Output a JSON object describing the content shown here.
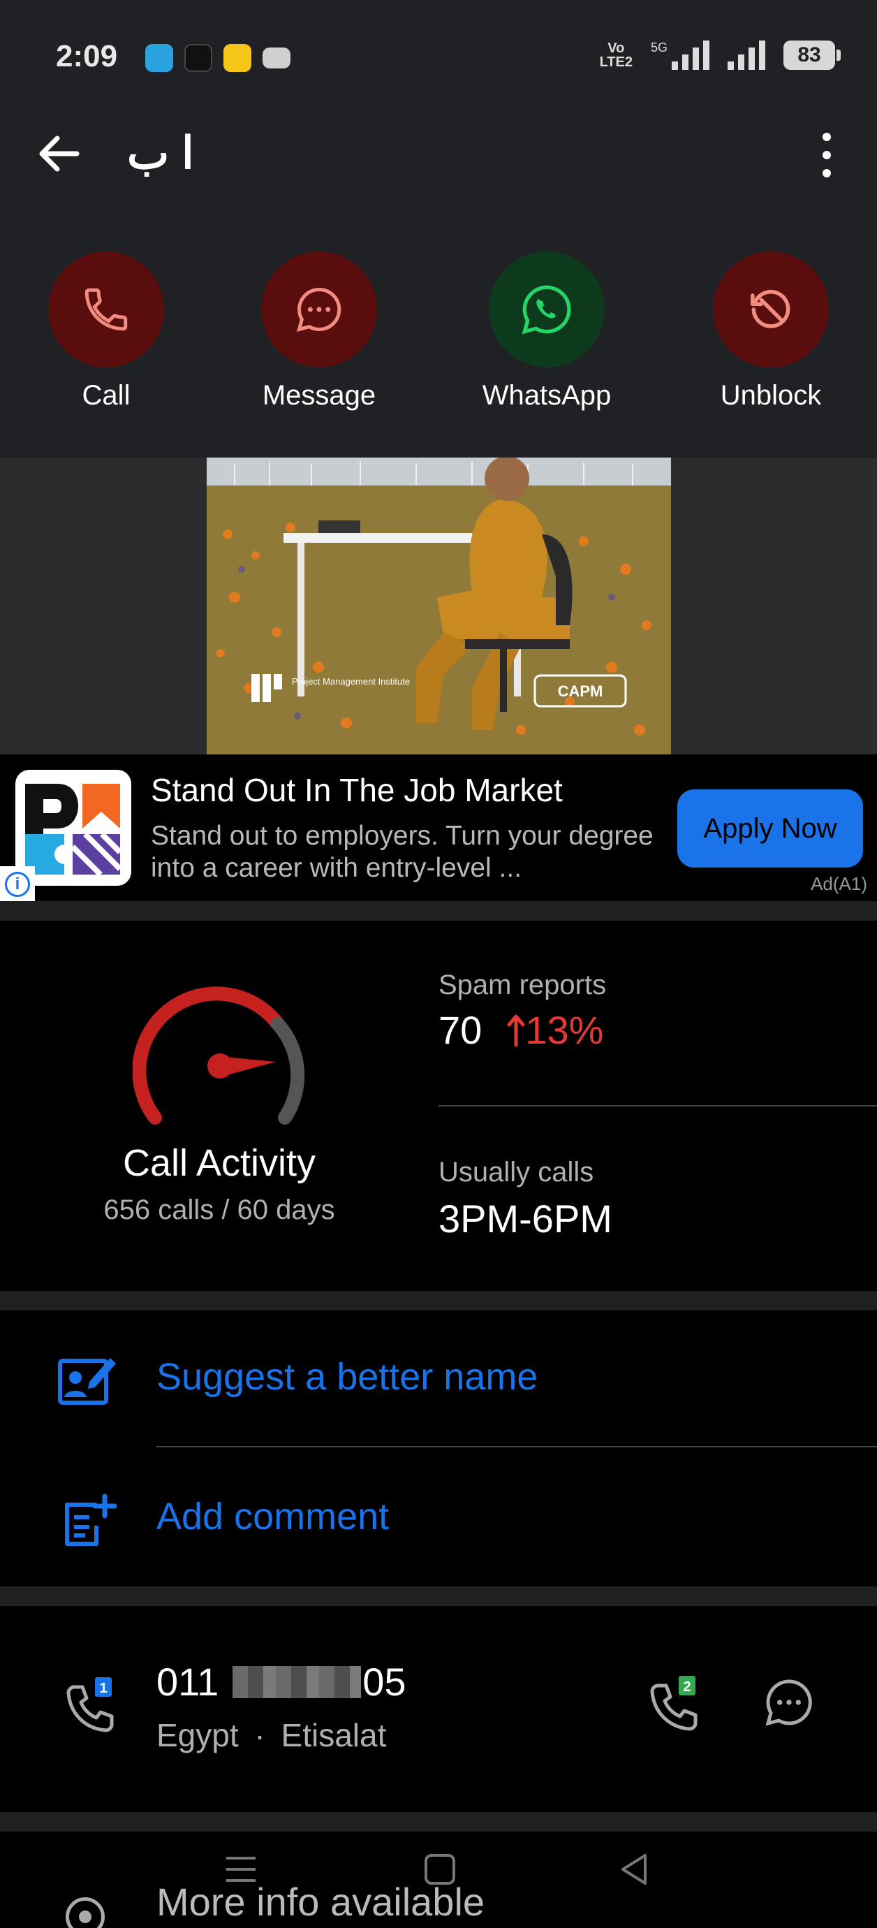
{
  "status_bar": {
    "time": "2:09",
    "notifications": [
      "telegram-icon",
      "tiktok-icon",
      "yellow-app-icon",
      "youtube-icon"
    ],
    "volte_top": "Vo",
    "volte_bottom": "LTE2",
    "network": "5G",
    "battery": "83"
  },
  "header": {
    "contact_name": "ا ب"
  },
  "actions": [
    {
      "label": "Call",
      "icon": "phone-icon",
      "color": "#5a0d0d"
    },
    {
      "label": "Message",
      "icon": "chat-icon",
      "color": "#5a0d0d"
    },
    {
      "label": "WhatsApp",
      "icon": "whatsapp-icon",
      "color": "#0d3a1c"
    },
    {
      "label": "Unblock",
      "icon": "unblock-icon",
      "color": "#5a0d0d"
    }
  ],
  "ad": {
    "image_badge": "CAPM",
    "image_brand": "Project Management Institute",
    "title": "Stand Out In The Job Market",
    "description": "Stand out to employers. Turn your degree into a career with entry-level ...",
    "cta": "Apply Now",
    "tag": "Ad(A1)"
  },
  "activity": {
    "title": "Call Activity",
    "subtitle": "656 calls / 60 days",
    "spam_label": "Spam reports",
    "spam_count": "70",
    "spam_change": "13%",
    "calls_label": "Usually calls",
    "calls_value": "3PM-6PM"
  },
  "list_actions": {
    "suggest": "Suggest a better name",
    "comment": "Add comment"
  },
  "number": {
    "prefix": "011",
    "suffix": "05",
    "country": "Egypt",
    "separator": "·",
    "carrier": "Etisalat",
    "sim1": "1",
    "sim2": "2"
  },
  "more": {
    "label": "More info available"
  },
  "colors": {
    "accent": "#1a73e8",
    "danger": "#e53935",
    "panel": "#202124"
  }
}
